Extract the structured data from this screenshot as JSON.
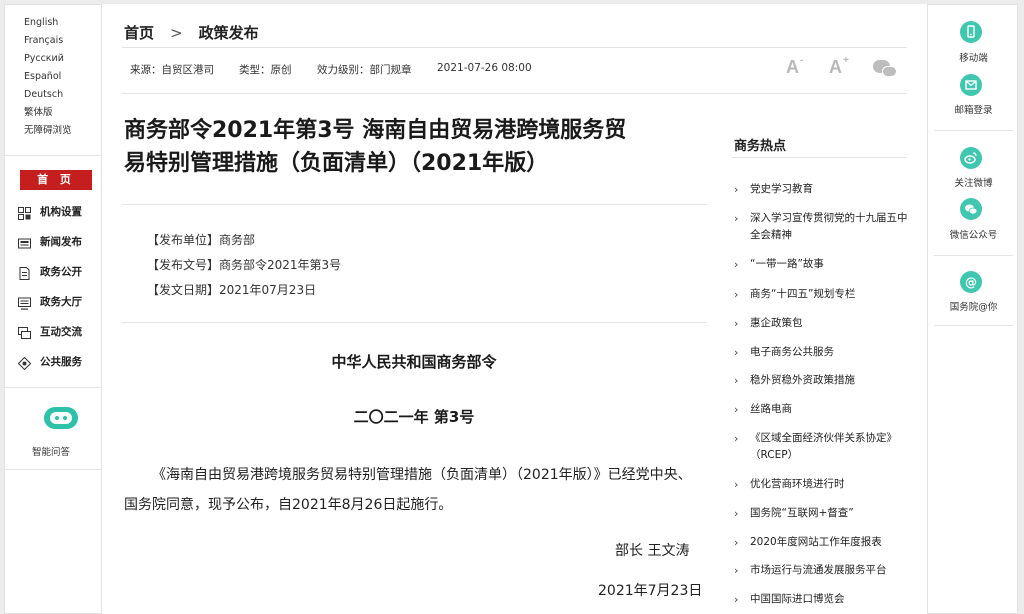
{
  "languages": [
    "English",
    "Français",
    "Русский",
    "Español",
    "Deutsch",
    "繁体版",
    "无障碍浏览"
  ],
  "left_nav": {
    "home": "首 页",
    "items": [
      {
        "label": "机构设置",
        "icon": "org-grid-icon"
      },
      {
        "label": "新闻发布",
        "icon": "news-icon"
      },
      {
        "label": "政务公开",
        "icon": "document-icon"
      },
      {
        "label": "政务大厅",
        "icon": "monitor-icon"
      },
      {
        "label": "互动交流",
        "icon": "chat-icon"
      },
      {
        "label": "公共服务",
        "icon": "service-icon"
      }
    ],
    "ai_label": "智能问答"
  },
  "breadcrumb": {
    "home": "首页",
    "current": "政策发布"
  },
  "meta": {
    "source": "来源：自贸区港司",
    "type": "类型：原创",
    "level": "效力级别：部门规章",
    "datetime": "2021-07-26 08:00"
  },
  "font_controls": {
    "decrease": "A",
    "increase": "A",
    "decrease_mark": "-",
    "increase_mark": "+"
  },
  "article": {
    "title_line1": "商务部令2021年第3号 海南自由贸易港跨境服务贸",
    "title_line2": "易特别管理措施（负面清单）（2021年版）",
    "publisher": "【发布单位】商务部",
    "doc_no": "【发布文号】商务部令2021年第3号",
    "date": "【发文日期】2021年07月23日",
    "heading": "中华人民共和国商务部令",
    "number": "二〇二一年  第3号",
    "body": "《海南自由贸易港跨境服务贸易特别管理措施（负面清单）（2021年版）》已经党中央、国务院同意，现予公布，自2021年8月26日起施行。",
    "signer": "部长  王文涛",
    "sign_date": "2021年7月23日"
  },
  "hot": {
    "title": "商务热点",
    "items": [
      "党史学习教育",
      "深入学习宣传贯彻党的十九届五中全会精神",
      "“一带一路”故事",
      "商务“十四五”规划专栏",
      "惠企政策包",
      "电子商务公共服务",
      "稳外贸稳外资政策措施",
      "丝路电商",
      "《区域全面经济伙伴关系协定》（RCEP）",
      "优化营商环境进行时",
      "国务院“互联网+督查”",
      "2020年度网站工作年度报表",
      "市场运行与流通发展服务平台",
      "中国国际进口博览会"
    ]
  },
  "right_bar": [
    {
      "label": "移动端",
      "icon": "mobile-icon"
    },
    {
      "label": "邮箱登录",
      "icon": "mail-icon"
    },
    {
      "label": "关注微博",
      "icon": "weibo-icon"
    },
    {
      "label": "微信公众号",
      "icon": "wechat-icon"
    },
    {
      "label": "国务院@你",
      "icon": "at-icon"
    }
  ],
  "colors": {
    "accent_red": "#c41e1e",
    "teal": "#41c6b0"
  }
}
